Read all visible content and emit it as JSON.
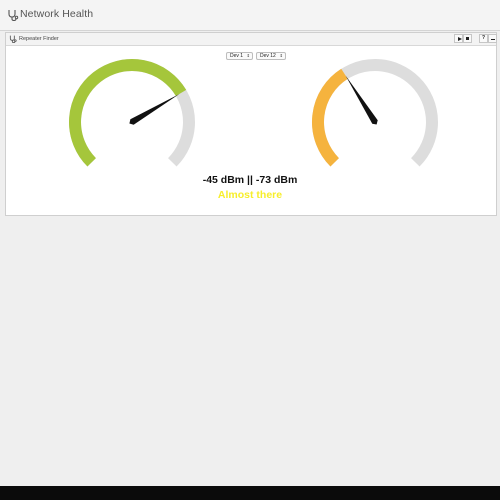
{
  "app": {
    "title": "Network Health",
    "icon": "stethoscope-icon"
  },
  "panel": {
    "title": "Repeater Finder",
    "icon": "stethoscope-icon",
    "controls": {
      "play": "play-icon",
      "stop": "stop-icon",
      "help_label": "?",
      "minimize": "minimize-icon"
    }
  },
  "selectors": {
    "device_a": "Dev 1",
    "device_b": "Dev 12"
  },
  "gauges": [
    {
      "device": "Dev 1",
      "dbm": -45,
      "level": 0.72,
      "color": "#a5c63b"
    },
    {
      "device": "Dev 12",
      "dbm": -73,
      "level": 0.38,
      "color": "#f5b33e"
    }
  ],
  "colors": {
    "track": "#dddddd",
    "needle": "#111111",
    "status": "#f7ee2b"
  },
  "reading": {
    "text": "-45 dBm || -73 dBm",
    "status": "Almost there"
  }
}
